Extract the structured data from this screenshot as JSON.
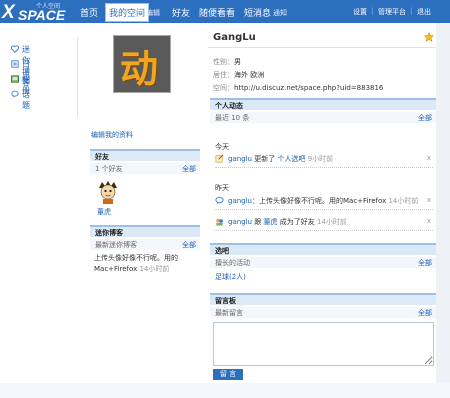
{
  "colors": {
    "topbar": "#2d6fbf",
    "link": "#1a5fb4",
    "section_head": "#dbe8f6"
  },
  "logo": {
    "x": "X",
    "space": "SPACE",
    "sub": "个人空间"
  },
  "nav": {
    "home": "首页",
    "my_space": "我的空间",
    "edit": "编辑",
    "friends": "好友",
    "browse": "随便看看",
    "messages": "短消息",
    "notify": "通知",
    "settings": "设置",
    "admin": "管理平台",
    "logout": "退出"
  },
  "sidebar": {
    "items": [
      {
        "label": "迷你博客",
        "icon": "heart-icon"
      },
      {
        "label": "日志",
        "icon": "doc-icon"
      },
      {
        "label": "相册",
        "icon": "image-icon"
      },
      {
        "label": "话题",
        "icon": "chat-icon"
      }
    ]
  },
  "profile": {
    "avatar_char": "动",
    "edit_link": "编辑我的资料",
    "name": "GangLu",
    "gender_label": "性别：",
    "gender": "男",
    "location_label": "居住：",
    "location": "海外 欧洲",
    "space_label": "空间：",
    "space_url": "http://u.discuz.net/space.php?uid=883816"
  },
  "friends": {
    "title": "好友",
    "count": "1 个好友",
    "all": "全部",
    "items": [
      {
        "name": "董虎"
      }
    ]
  },
  "miniblog": {
    "title": "迷你博客",
    "latest": "最新迷你博客",
    "all": "全部",
    "text": "上传头像好像不行呢。用的Mac+Firefox",
    "time": "14小时前"
  },
  "feed": {
    "title": "个人动态",
    "recent": "最近  10 条",
    "all": "全部",
    "today": "今天",
    "yesterday": "昨天",
    "items": [
      {
        "user": "ganglu",
        "action": "更新了",
        "target": "个人选吧",
        "time": "9小时前"
      },
      {
        "user": "ganglu",
        "action": "：上传头像好像不行呢。用的Mac+Firefox",
        "target": "",
        "time": "14小时前"
      },
      {
        "user": "ganglu",
        "action": "跟",
        "target": "董虎",
        "action2": "成为了好友",
        "time": "14小时前"
      }
    ],
    "close": "x"
  },
  "club": {
    "title": "选吧",
    "recent": "擅长的活动",
    "all": "全部",
    "item": "足球(2人)"
  },
  "guestbook": {
    "title": "留言板",
    "recent": "最新留言",
    "all": "全部",
    "button": "留 言"
  }
}
